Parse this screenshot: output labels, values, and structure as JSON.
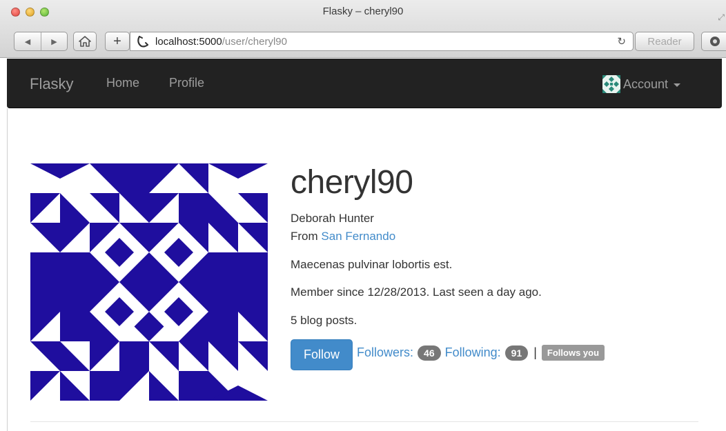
{
  "window": {
    "title": "Flasky – cheryl90"
  },
  "address_bar": {
    "host": "localhost:5000",
    "path": "/user/cheryl90",
    "reader_label": "Reader"
  },
  "navbar": {
    "brand": "Flasky",
    "links": [
      {
        "label": "Home"
      },
      {
        "label": "Profile"
      }
    ],
    "account_label": "Account"
  },
  "profile": {
    "username": "cheryl90",
    "full_name": "Deborah Hunter",
    "from_prefix": "From",
    "location": "San Fernando",
    "about": "Maecenas pulvinar lobortis est.",
    "member_since": "Member since 12/28/2013. Last seen a day ago.",
    "blog_posts": "5 blog posts.",
    "follow_label": "Follow",
    "followers_label": "Followers:",
    "followers_count": "46",
    "following_label": "Following:",
    "following_count": "91",
    "separator": "|",
    "follows_you_label": "Follows you"
  },
  "colors": {
    "avatar_primary": "#1f0e9e",
    "link": "#428bca",
    "navbar_bg": "#222222"
  },
  "icons": {
    "back": "back-arrow-icon",
    "forward": "forward-arrow-icon",
    "home": "home-icon",
    "add_tab": "plus-icon",
    "favicon": "favicon-icon",
    "reload": "reload-icon",
    "extension": "extension-icon",
    "account_avatar": "identicon-avatar",
    "caret": "caret-down-icon"
  }
}
